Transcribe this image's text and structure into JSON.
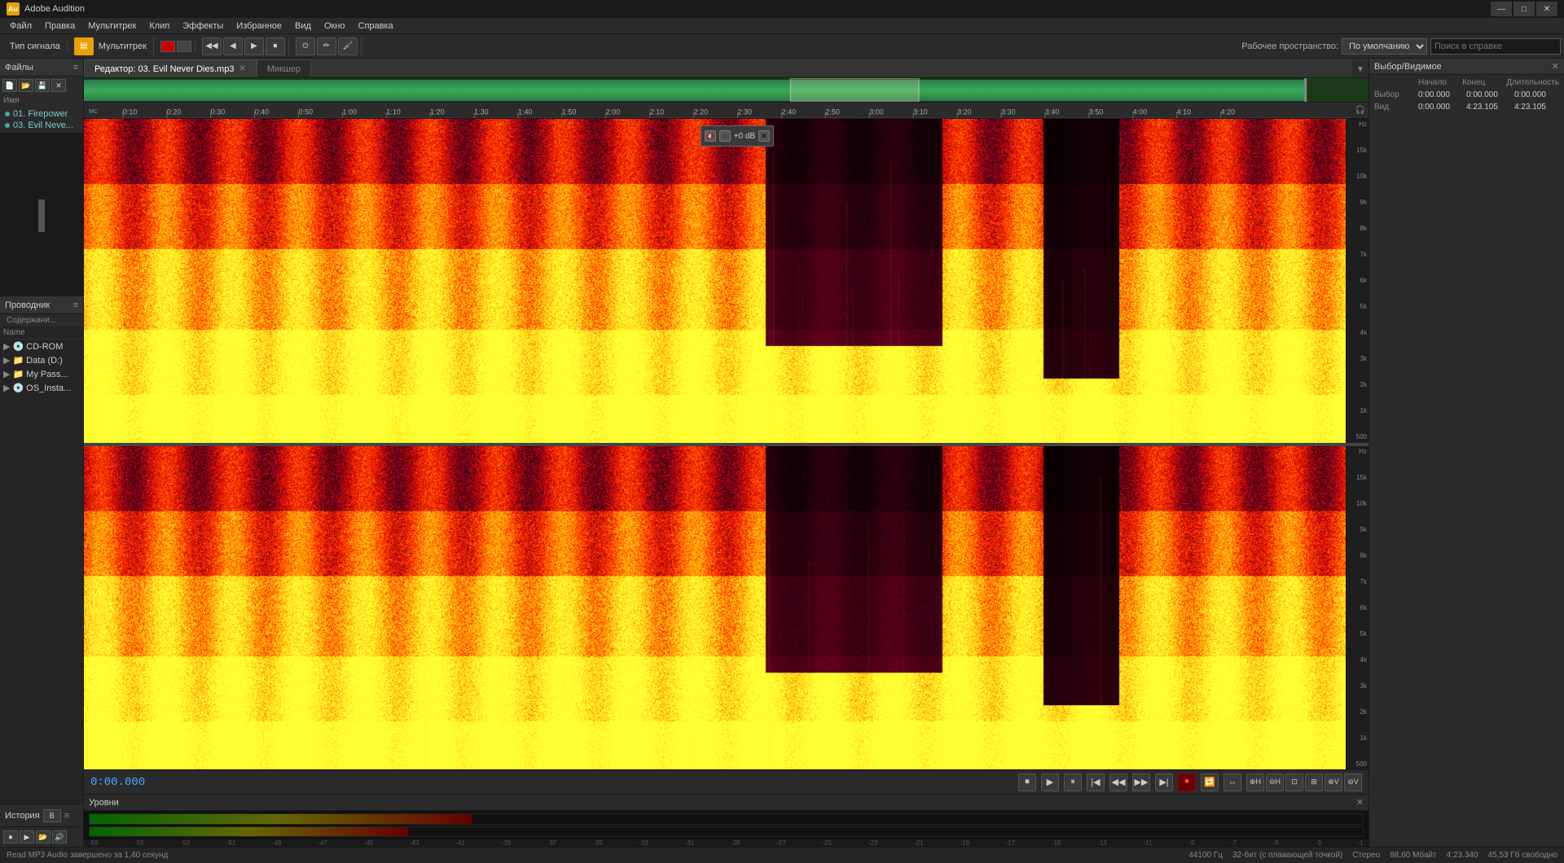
{
  "app": {
    "title": "Adobe Audition",
    "icon_letter": "Au"
  },
  "title_bar": {
    "title": "Adobe Audition",
    "minimize_label": "—",
    "maximize_label": "□",
    "close_label": "✕"
  },
  "menu": {
    "items": [
      "Файл",
      "Правка",
      "Мультитрек",
      "Клип",
      "Эффекты",
      "Избранное",
      "Вид",
      "Окно",
      "Справка"
    ]
  },
  "toolbar": {
    "signal_type_label": "Тип сигнала",
    "multitrack_label": "Мультитрек",
    "workspace_label": "Рабочее пространство:",
    "workspace_default": "По умолчанию",
    "search_placeholder": "Поиск в справке"
  },
  "files_panel": {
    "title": "Файлы",
    "items": [
      "01. Firepower",
      "03. Evil Neve..."
    ]
  },
  "explorer_panel": {
    "title": "Проводник",
    "content_label": "Содержание",
    "name_header": "Name",
    "tree_items": [
      {
        "label": "CD-ROM",
        "type": "drive"
      },
      {
        "label": "Data (D:)",
        "type": "drive"
      },
      {
        "label": "My Pass...",
        "type": "folder"
      },
      {
        "label": "OS_Insta...",
        "type": "drive"
      }
    ]
  },
  "history_panel": {
    "label": "История",
    "b_label": "B"
  },
  "tabs": {
    "editor_tab": "Редактор: 03. Evil Never Dies.mp3",
    "mixer_tab": "Микшер"
  },
  "time_ruler": {
    "label_start": "мс",
    "ticks": [
      "0:10",
      "0:20",
      "0:30",
      "0:40",
      "0:50",
      "1:00",
      "1:10",
      "1:20",
      "1:30",
      "1:40",
      "1:50",
      "2:00",
      "2:10",
      "2:20",
      "2:30",
      "2:40",
      "2:50",
      "3:00",
      "3:10",
      "3:20",
      "3:30",
      "3:40",
      "3:50",
      "4:00",
      "4:10",
      "4:20"
    ]
  },
  "freq_scale_upper": [
    "Hz",
    "15k",
    "10k",
    "9k",
    "8k",
    "7k",
    "6k",
    "5k",
    "4k",
    "3k",
    "2k",
    "1k",
    "500"
  ],
  "freq_scale_lower": [
    "Hz",
    "15k",
    "10k",
    "9k",
    "8k",
    "7k",
    "6k",
    "5k",
    "4k",
    "3k",
    "2k",
    "1k",
    "500"
  ],
  "popup_overlay": {
    "db_value": "+0 dB"
  },
  "transport": {
    "time": "0:00.000",
    "buttons": [
      "stop",
      "play",
      "pause",
      "rewind",
      "fast-rewind",
      "fast-forward",
      "end",
      "record",
      "loop",
      "in-out"
    ]
  },
  "levels": {
    "title": "Уровни",
    "db_marks": [
      "-59",
      "-55",
      "-53",
      "-51",
      "-49",
      "-47",
      "-45",
      "-43",
      "-41",
      "-39",
      "-37",
      "-35",
      "-33",
      "-31",
      "-29",
      "-27",
      "-25",
      "-23",
      "-21",
      "-19",
      "-17",
      "-15",
      "-13",
      "-11",
      "-9",
      "-7",
      "-5",
      "-3",
      "-1"
    ]
  },
  "status_bar": {
    "message": "Read MP3 Audio завершено за 1,40 секунд",
    "sample_rate": "44100 Гц",
    "bit_depth": "32-бит (с плавающей точкой)",
    "channels": "Стерео",
    "size": "88,60 Мбайт",
    "duration": "4:23.340",
    "free_space": "45,53 Гб свободно"
  },
  "selection_panel": {
    "title": "Выбор/Видимое",
    "start_label": "Начало",
    "end_label": "Конец",
    "duration_label": "Длительность",
    "selection_label": "Выбор",
    "view_label": "Вид",
    "selection_start": "0:00.000",
    "selection_end": "0:00.000",
    "selection_duration": "0:00.000",
    "view_start": "0:00.000",
    "view_end": "4:23.105",
    "view_duration": "4:23.105"
  }
}
